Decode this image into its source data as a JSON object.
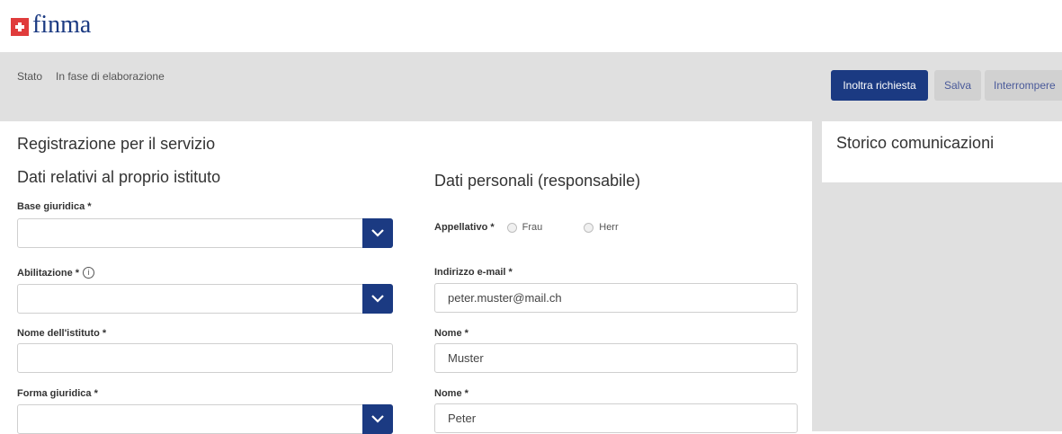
{
  "brand": {
    "logo_text": "finma"
  },
  "status": {
    "label": "Stato",
    "value": "In fase di elaborazione"
  },
  "actions": {
    "submit": "Inoltra richiesta",
    "save": "Salva",
    "cancel": "Interrompere"
  },
  "form": {
    "title": "Registrazione per il servizio",
    "institution_section": "Dati relativi al proprio istituto",
    "personal_section": "Dati personali (responsabile)",
    "fields": {
      "legal_basis": {
        "label": "Base giuridica *",
        "value": ""
      },
      "authorization": {
        "label": "Abilitazione *",
        "value": ""
      },
      "institution_name": {
        "label": "Nome dell'istituto *",
        "value": ""
      },
      "legal_form": {
        "label": "Forma giuridica *",
        "value": ""
      },
      "salutation": {
        "label": "Appellativo *",
        "options": [
          "Frau",
          "Herr"
        ]
      },
      "email": {
        "label": "Indirizzo e-mail *",
        "value": "peter.muster@mail.ch"
      },
      "last_name": {
        "label": "Nome *",
        "value": "Muster"
      },
      "first_name": {
        "label": "Nome *",
        "value": "Peter"
      }
    }
  },
  "history": {
    "title": "Storico comunicazioni"
  },
  "colors": {
    "primary": "#1b3a82",
    "status_bg": "#e0e0e0",
    "logo_red": "#e03c3c"
  }
}
